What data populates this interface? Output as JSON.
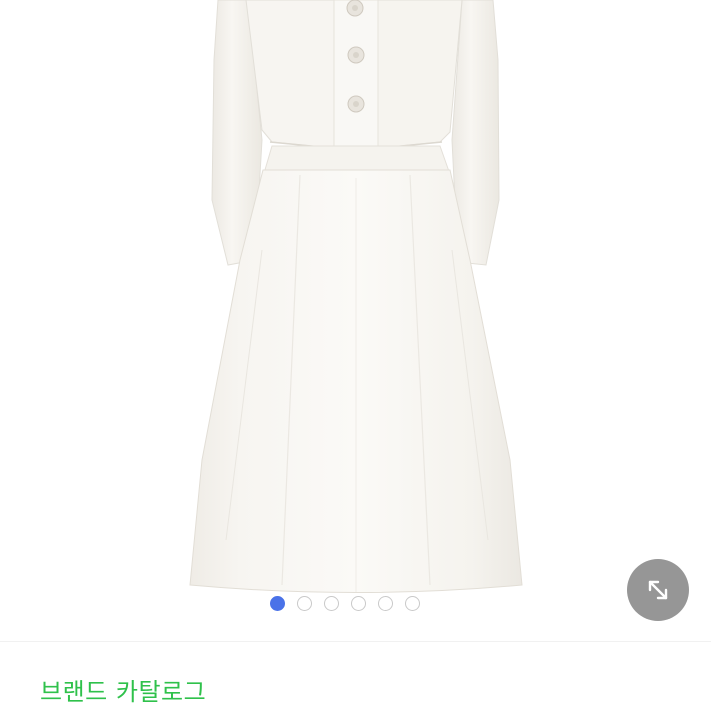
{
  "gallery": {
    "image_label": "product-photo",
    "slide_count": 6,
    "active_index": 0,
    "expand_icon": "expand-arrows-icon"
  },
  "brand_section": {
    "link_label": "브랜드 카탈로그",
    "link_color": "#2fc14b"
  },
  "colors": {
    "active_dot": "#4a72e8",
    "inactive_dot_border": "#c9c9c9",
    "expand_button_bg": "#787878"
  }
}
